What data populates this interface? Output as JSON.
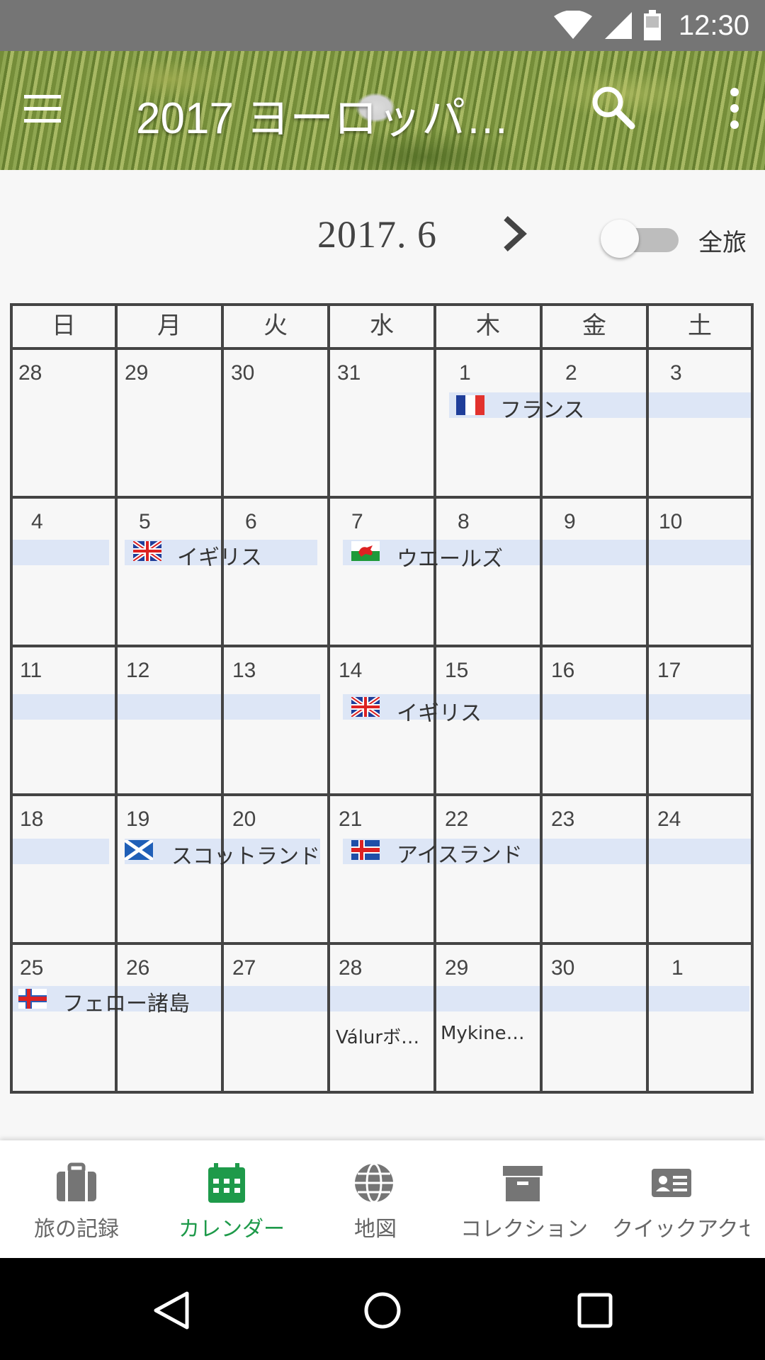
{
  "status_bar": {
    "time": "12:30"
  },
  "app_bar": {
    "title": "2017 ヨーロッパ…"
  },
  "calendar_header": {
    "month": "2017. 6",
    "toggle_label": "全旅",
    "toggle_on": false
  },
  "weekdays": [
    "日",
    "月",
    "火",
    "水",
    "木",
    "金",
    "土"
  ],
  "weeks": [
    [
      "28",
      "29",
      "30",
      "31",
      "1",
      "2",
      "3"
    ],
    [
      "4",
      "5",
      "6",
      "7",
      "8",
      "9",
      "10"
    ],
    [
      "11",
      "12",
      "13",
      "14",
      "15",
      "16",
      "17"
    ],
    [
      "18",
      "19",
      "20",
      "21",
      "22",
      "23",
      "24"
    ],
    [
      "25",
      "26",
      "27",
      "28",
      "29",
      "30",
      "1"
    ]
  ],
  "events": {
    "france": "フランス",
    "uk1": "イギリス",
    "wales": "ウエールズ",
    "uk2": "イギリス",
    "scotland": "スコットランド",
    "iceland": "アイスランド",
    "faroe": "フェロー諸島"
  },
  "notes": {
    "d28": "Válurボ…",
    "d29": "Mykine…"
  },
  "bottom_nav": [
    {
      "label": "旅の記録",
      "icon": "suitcase-icon"
    },
    {
      "label": "カレンダー",
      "icon": "calendar-icon",
      "active": true
    },
    {
      "label": "地図",
      "icon": "globe-icon"
    },
    {
      "label": "コレクション",
      "icon": "archive-box-icon"
    },
    {
      "label": "クイックアクセス",
      "icon": "id-card-icon"
    }
  ],
  "colors": {
    "accent": "#1e9a4a",
    "event_bar": "#dde6f6",
    "status_bar": "#757575"
  }
}
